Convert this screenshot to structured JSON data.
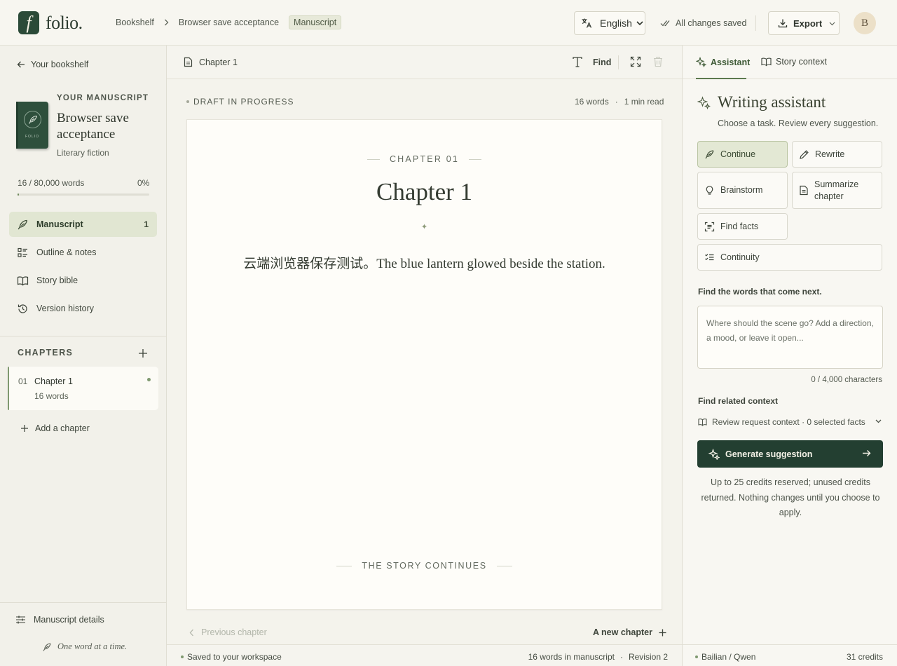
{
  "topbar": {
    "logo_mark": "f",
    "logo_text": "folio.",
    "breadcrumbs": [
      "Bookshelf",
      "Browser save acceptance"
    ],
    "breadcrumb_sep": ">",
    "breadcrumb_current": "Manuscript",
    "language": "English",
    "save_status": "All changes saved",
    "export_label": "Export",
    "avatar_initial": "B"
  },
  "sidebar": {
    "back_label": "Your bookshelf",
    "cover_brand": "FOLIO",
    "eyebrow": "YOUR MANUSCRIPT",
    "title": "Browser save acceptance",
    "genre": "Literary fiction",
    "word_count_label": "16 / 80,000 words",
    "progress_percent": "0%",
    "progress_fraction": 0.0002,
    "nav": [
      {
        "label": "Manuscript",
        "count": "1",
        "icon": "feather-icon"
      },
      {
        "label": "Outline & notes",
        "icon": "outline-icon"
      },
      {
        "label": "Story bible",
        "icon": "book-icon"
      },
      {
        "label": "Version history",
        "icon": "history-icon"
      }
    ],
    "chapters_heading": "CHAPTERS",
    "chapters": [
      {
        "number": "01",
        "title": "Chapter 1",
        "words": "16 words"
      }
    ],
    "add_chapter": "Add a chapter",
    "details_label": "Manuscript details",
    "tagline": "One word at a time."
  },
  "editor": {
    "tab_label": "Chapter 1",
    "find_label": "Find",
    "draft_status": "DRAFT IN PROGRESS",
    "word_count": "16 words",
    "sep": "·",
    "read_time": "1 min read",
    "chapter_eyebrow": "CHAPTER 01",
    "chapter_title": "Chapter 1",
    "ornament": "✦",
    "body": "云端浏览器保存测试。The blue lantern glowed beside the station.",
    "end_marker": "THE STORY CONTINUES",
    "prev_label": "Previous chapter",
    "next_label": "A new chapter"
  },
  "statusbar": {
    "saved": "Saved to your workspace",
    "manuscript_words": "16 words in manuscript",
    "sep": "·",
    "revision": "Revision 2"
  },
  "assistant": {
    "tabs": [
      "Assistant",
      "Story context"
    ],
    "title": "Writing assistant",
    "subtitle": "Choose a task. Review every suggestion.",
    "tasks": {
      "continue": "Continue",
      "rewrite": "Rewrite",
      "brainstorm": "Brainstorm",
      "summarize": "Summarize chapter",
      "find_facts": "Find facts",
      "continuity": "Continuity"
    },
    "prompt_label": "Find the words that come next.",
    "prompt_placeholder": "Where should the scene go? Add a direction, a mood, or leave it open...",
    "char_count": "0 / 4,000 characters",
    "context_label": "Find related context",
    "context_select": "Review request context · 0 selected facts",
    "generate_label": "Generate suggestion",
    "note": "Up to 25 credits reserved; unused credits returned. Nothing changes until you choose to apply.",
    "provider": "Bailian / Qwen",
    "credits": "31 credits"
  },
  "colors": {
    "accent_dark": "#233f31",
    "accent": "#7f9970",
    "active_bg": "#e1e6d2",
    "background": "#f4f3ec",
    "page": "#fefdf9"
  }
}
